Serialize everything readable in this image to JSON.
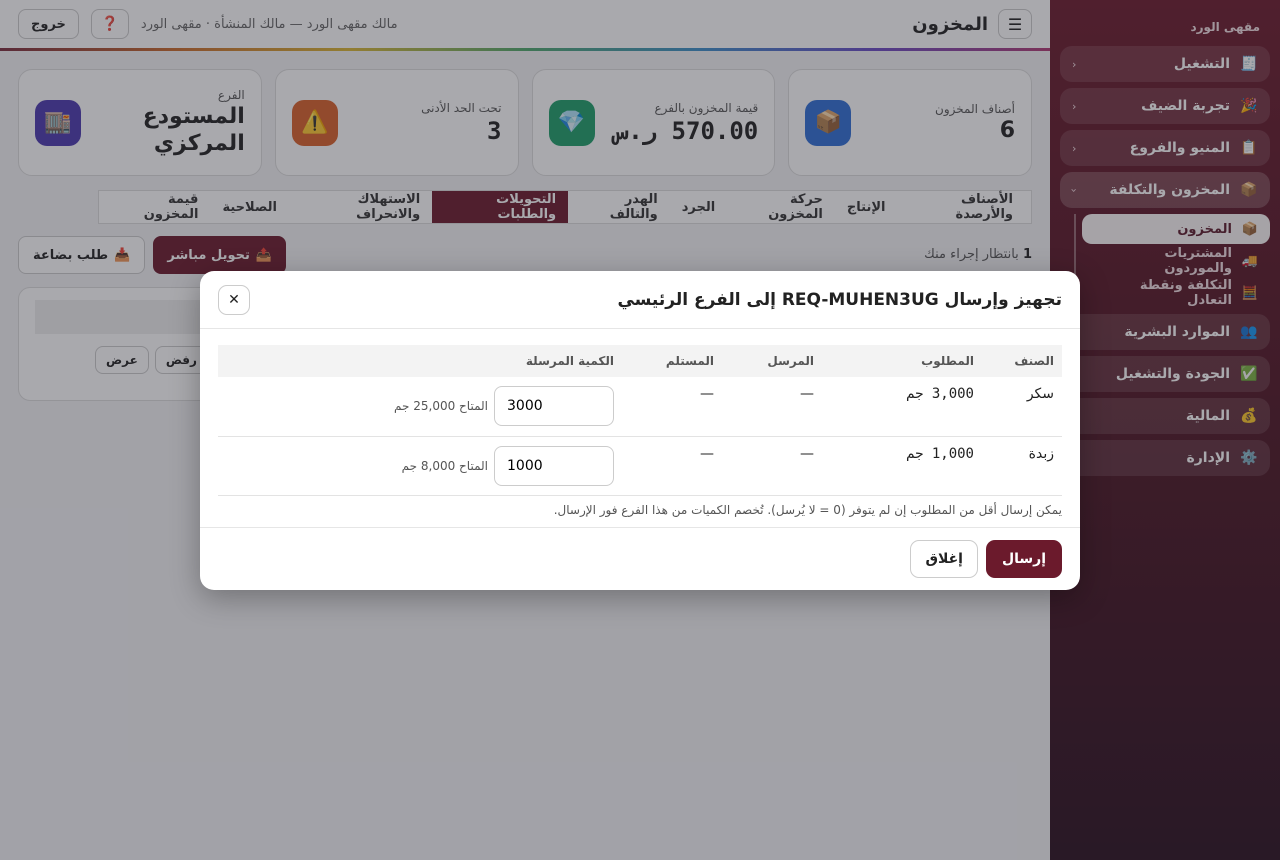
{
  "sidebar": {
    "brand": "مقهى الورد",
    "groups": [
      {
        "label": "التشغيل",
        "icon": "🧾",
        "chevron": "‹"
      },
      {
        "label": "تجربة الضيف",
        "icon": "🎉",
        "chevron": "‹"
      },
      {
        "label": "المنيو والفروع",
        "icon": "📋",
        "chevron": "‹"
      },
      {
        "label": "المخزون والتكلفة",
        "icon": "📦",
        "chevron": "‹"
      },
      {
        "label": "الموارد البشرية",
        "icon": "👥"
      },
      {
        "label": "الجودة والتشغيل",
        "icon": "✅"
      },
      {
        "label": "المالية",
        "icon": "💰"
      },
      {
        "label": "الإدارة",
        "icon": "⚙️"
      }
    ],
    "subitems": [
      {
        "label": "المخزون",
        "icon": "📦"
      },
      {
        "label": "المشتريات والموردون",
        "icon": "🚚"
      },
      {
        "label": "التكلفة ونقطة التعادل",
        "icon": "🧮"
      }
    ]
  },
  "topbar": {
    "menu_icon": "☰",
    "title": "المخزون",
    "owner": "مالك مقهى الورد — مالك المنشأة · مقهى الورد",
    "help_icon": "❓",
    "logout": "خروج"
  },
  "stats": [
    {
      "label": "أصناف المخزون",
      "value": "6",
      "icon": "📦",
      "color": "#2f6fd6"
    },
    {
      "label": "قيمة المخزون بالفرع",
      "value": "570.00 ر.س",
      "icon": "💎",
      "color": "#1e9e6a"
    },
    {
      "label": "تحت الحد الأدنى",
      "value": "3",
      "icon": "⚠️",
      "color": "#d9622b"
    },
    {
      "label": "الفرع",
      "value_line1": "المستودع",
      "value_line2": "المركزي",
      "icon": "🏬",
      "color": "#4b3ab0"
    }
  ],
  "tabs": [
    "الأصناف والأرصدة",
    "الإنتاج",
    "حركة المخزون",
    "الجرد",
    "الهدر والتالف",
    "التحويلات والطلبات",
    "الاستهلاك والانحراف",
    "الصلاحية",
    "قيمة المخزون"
  ],
  "pending": {
    "count": "1",
    "text": "بانتظار إجراء منك"
  },
  "actions": {
    "request": {
      "label": "طلب بضاعة",
      "icon": "📥"
    },
    "transfer": {
      "label": "تحويل مباشر",
      "icon": "📤"
    }
  },
  "row_buttons": {
    "reject": "رفض",
    "view": "عرض"
  },
  "modal": {
    "title": "تجهيز وإرسال REQ-MUHEN3UG إلى الفرع الرئيسي",
    "close_icon": "✕",
    "columns": [
      "الصنف",
      "المطلوب",
      "المرسل",
      "المستلم",
      "الكمية المرسلة"
    ],
    "rows": [
      {
        "item": "سكر",
        "requested": "3,000 جم",
        "sent": "—",
        "received": "—",
        "qty": "3000",
        "available": "المتاح 25,000 جم"
      },
      {
        "item": "زبدة",
        "requested": "1,000 جم",
        "sent": "—",
        "received": "—",
        "qty": "1000",
        "available": "المتاح 8,000 جم"
      }
    ],
    "note": "يمكن إرسال أقل من المطلوب إن لم يتوفر (0 = لا يُرسل). تُخصم الكميات من هذا الفرع فور الإرسال.",
    "send": "إرسال",
    "close": "إغلاق"
  }
}
